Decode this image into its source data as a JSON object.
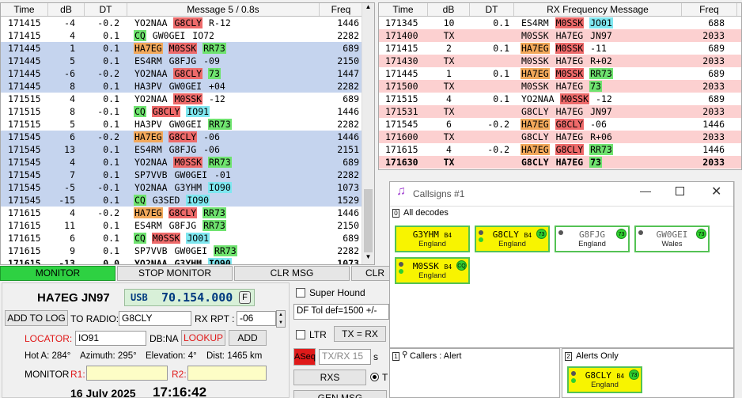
{
  "left_grid": {
    "headers": [
      "Time",
      "dB",
      "DT",
      "Message 5 / 0.8s",
      "Freq"
    ],
    "rows": [
      {
        "t": "171415",
        "db": "-4",
        "dt": "-0.2",
        "msg": [
          [
            "YO2NAA",
            ""
          ],
          [
            "G8CLY",
            "red"
          ],
          [
            "R-12",
            ""
          ]
        ],
        "f": "1446",
        "cls": ""
      },
      {
        "t": "171415",
        "db": "4",
        "dt": "0.1",
        "msg": [
          [
            "CQ",
            "grn"
          ],
          [
            "GW0GEI",
            ""
          ],
          [
            "IO72",
            ""
          ]
        ],
        "f": "2282",
        "cls": ""
      },
      {
        "t": "171445",
        "db": "1",
        "dt": "0.1",
        "msg": [
          [
            "HA7EG",
            "org"
          ],
          [
            "M0SSK",
            "red"
          ],
          [
            "RR73",
            "grn"
          ]
        ],
        "f": "689",
        "cls": "blue-row"
      },
      {
        "t": "171445",
        "db": "5",
        "dt": "0.1",
        "msg": [
          [
            "ES4RM",
            ""
          ],
          [
            "G8FJG",
            ""
          ],
          [
            "-09",
            ""
          ]
        ],
        "f": "2150",
        "cls": "blue-row"
      },
      {
        "t": "171445",
        "db": "-6",
        "dt": "-0.2",
        "msg": [
          [
            "YO2NAA",
            ""
          ],
          [
            "G8CLY",
            "red"
          ],
          [
            "73",
            "grn"
          ]
        ],
        "f": "1447",
        "cls": "blue-row"
      },
      {
        "t": "171445",
        "db": "8",
        "dt": "0.1",
        "msg": [
          [
            "HA3PV",
            ""
          ],
          [
            "GW0GEI",
            ""
          ],
          [
            "+04",
            ""
          ]
        ],
        "f": "2282",
        "cls": "blue-row"
      },
      {
        "t": "171515",
        "db": "4",
        "dt": "0.1",
        "msg": [
          [
            "YO2NAA",
            ""
          ],
          [
            "M0SSK",
            "red"
          ],
          [
            "-12",
            ""
          ]
        ],
        "f": "689",
        "cls": ""
      },
      {
        "t": "171515",
        "db": "8",
        "dt": "-0.1",
        "msg": [
          [
            "CQ",
            "grn"
          ],
          [
            "G8CLY",
            "red"
          ],
          [
            "IO91",
            "cyan"
          ]
        ],
        "f": "1446",
        "cls": ""
      },
      {
        "t": "171515",
        "db": "5",
        "dt": "0.1",
        "msg": [
          [
            "HA3PV",
            ""
          ],
          [
            "GW0GEI",
            ""
          ],
          [
            "RR73",
            "grn"
          ]
        ],
        "f": "2282",
        "cls": ""
      },
      {
        "t": "171545",
        "db": "6",
        "dt": "-0.2",
        "msg": [
          [
            "HA7EG",
            "org"
          ],
          [
            "G8CLY",
            "red"
          ],
          [
            "-06",
            ""
          ]
        ],
        "f": "1446",
        "cls": "blue-row"
      },
      {
        "t": "171545",
        "db": "13",
        "dt": "0.1",
        "msg": [
          [
            "ES4RM",
            ""
          ],
          [
            "G8FJG",
            ""
          ],
          [
            "-06",
            ""
          ]
        ],
        "f": "2151",
        "cls": "blue-row"
      },
      {
        "t": "171545",
        "db": "4",
        "dt": "0.1",
        "msg": [
          [
            "YO2NAA",
            ""
          ],
          [
            "M0SSK",
            "red"
          ],
          [
            "RR73",
            "grn"
          ]
        ],
        "f": "689",
        "cls": "blue-row"
      },
      {
        "t": "171545",
        "db": "7",
        "dt": "0.1",
        "msg": [
          [
            "SP7VVB",
            ""
          ],
          [
            "GW0GEI",
            ""
          ],
          [
            "-01",
            ""
          ]
        ],
        "f": "2282",
        "cls": "blue-row"
      },
      {
        "t": "171545",
        "db": "-5",
        "dt": "-0.1",
        "msg": [
          [
            "YO2NAA",
            ""
          ],
          [
            "G3YHM",
            ""
          ],
          [
            "IO90",
            "cyan"
          ]
        ],
        "f": "1073",
        "cls": "blue-row"
      },
      {
        "t": "171545",
        "db": "-15",
        "dt": "0.1",
        "msg": [
          [
            "CQ",
            "grn"
          ],
          [
            "G3SED",
            ""
          ],
          [
            "IO90",
            "cyan"
          ]
        ],
        "f": "1529",
        "cls": "blue-row"
      },
      {
        "t": "171615",
        "db": "4",
        "dt": "-0.2",
        "msg": [
          [
            "HA7EG",
            "org"
          ],
          [
            "G8CLY",
            "red"
          ],
          [
            "RR73",
            "grn"
          ]
        ],
        "f": "1446",
        "cls": ""
      },
      {
        "t": "171615",
        "db": "11",
        "dt": "0.1",
        "msg": [
          [
            "ES4RM",
            ""
          ],
          [
            "G8FJG",
            ""
          ],
          [
            "RR73",
            "grn"
          ]
        ],
        "f": "2150",
        "cls": ""
      },
      {
        "t": "171615",
        "db": "6",
        "dt": "0.1",
        "msg": [
          [
            "CQ",
            "grn"
          ],
          [
            "M0SSK",
            "red"
          ],
          [
            "JO01",
            "cyan"
          ]
        ],
        "f": "689",
        "cls": ""
      },
      {
        "t": "171615",
        "db": "9",
        "dt": "0.1",
        "msg": [
          [
            "SP7VVB",
            ""
          ],
          [
            "GW0GEI",
            ""
          ],
          [
            "RR73",
            "grn"
          ]
        ],
        "f": "2282",
        "cls": ""
      },
      {
        "t": "171615",
        "db": "-13",
        "dt": "0.0",
        "msg": [
          [
            "YO2NAA",
            ""
          ],
          [
            "G3YHM",
            ""
          ],
          [
            "IO90",
            "cyan"
          ]
        ],
        "f": "1073",
        "cls": "bold"
      }
    ]
  },
  "right_grid": {
    "headers": [
      "Time",
      "dB",
      "DT",
      "RX Frequency Message",
      "Freq"
    ],
    "rows": [
      {
        "t": "171345",
        "db": "10",
        "dt": "0.1",
        "msg": [
          [
            "ES4RM",
            ""
          ],
          [
            "M0SSK",
            "red"
          ],
          [
            "JO01",
            "cyan"
          ]
        ],
        "f": "688",
        "cls": ""
      },
      {
        "t": "171400",
        "db": "TX",
        "dt": "",
        "msg": [
          [
            "M0SSK",
            ""
          ],
          [
            "HA7EG",
            ""
          ],
          [
            "JN97",
            ""
          ]
        ],
        "f": "2033",
        "cls": "pink-row"
      },
      {
        "t": "171415",
        "db": "2",
        "dt": "0.1",
        "msg": [
          [
            "HA7EG",
            "org"
          ],
          [
            "M0SSK",
            "red"
          ],
          [
            "-11",
            ""
          ]
        ],
        "f": "689",
        "cls": ""
      },
      {
        "t": "171430",
        "db": "TX",
        "dt": "",
        "msg": [
          [
            "M0SSK",
            ""
          ],
          [
            "HA7EG",
            ""
          ],
          [
            "R+02",
            ""
          ]
        ],
        "f": "2033",
        "cls": "pink-row"
      },
      {
        "t": "171445",
        "db": "1",
        "dt": "0.1",
        "msg": [
          [
            "HA7EG",
            "org"
          ],
          [
            "M0SSK",
            "red"
          ],
          [
            "RR73",
            "grn"
          ]
        ],
        "f": "689",
        "cls": ""
      },
      {
        "t": "171500",
        "db": "TX",
        "dt": "",
        "msg": [
          [
            "M0SSK",
            ""
          ],
          [
            "HA7EG",
            ""
          ],
          [
            "73",
            "grn"
          ]
        ],
        "f": "2033",
        "cls": "pink-row"
      },
      {
        "t": "171515",
        "db": "4",
        "dt": "0.1",
        "msg": [
          [
            "YO2NAA",
            ""
          ],
          [
            "M0SSK",
            "red"
          ],
          [
            "-12",
            ""
          ]
        ],
        "f": "689",
        "cls": ""
      },
      {
        "t": "171531",
        "db": "TX",
        "dt": "",
        "msg": [
          [
            "G8CLY",
            ""
          ],
          [
            "HA7EG",
            ""
          ],
          [
            "JN97",
            ""
          ]
        ],
        "f": "2033",
        "cls": "pink-row"
      },
      {
        "t": "171545",
        "db": "6",
        "dt": "-0.2",
        "msg": [
          [
            "HA7EG",
            "org"
          ],
          [
            "G8CLY",
            "red"
          ],
          [
            "-06",
            ""
          ]
        ],
        "f": "1446",
        "cls": ""
      },
      {
        "t": "171600",
        "db": "TX",
        "dt": "",
        "msg": [
          [
            "G8CLY",
            ""
          ],
          [
            "HA7EG",
            ""
          ],
          [
            "R+06",
            ""
          ]
        ],
        "f": "2033",
        "cls": "pink-row"
      },
      {
        "t": "171615",
        "db": "4",
        "dt": "-0.2",
        "msg": [
          [
            "HA7EG",
            "org"
          ],
          [
            "G8CLY",
            "red"
          ],
          [
            "RR73",
            "grn"
          ]
        ],
        "f": "1446",
        "cls": ""
      },
      {
        "t": "171630",
        "db": "TX",
        "dt": "",
        "msg": [
          [
            "G8CLY",
            ""
          ],
          [
            "HA7EG",
            ""
          ],
          [
            "73",
            "grn"
          ]
        ],
        "f": "2033",
        "cls": "pink-row bold"
      }
    ]
  },
  "controls": {
    "monitor": "MONITOR",
    "stop_monitor": "STOP MONITOR",
    "clr_msg": "CLR MSG",
    "clr2": "CLR",
    "station": "HA7EG JN97",
    "mode": "USB",
    "freq": "70.154.000",
    "f_btn": "F",
    "add_to_log": "ADD TO LOG",
    "to_radio_label": "TO RADIO:",
    "to_radio_value": "G8CLY",
    "rx_rpt_label": "RX RPT :",
    "rx_rpt_value": "-06",
    "locator_label": "LOCATOR:",
    "locator_value": "IO91",
    "dbna_label": "DB:NA",
    "lookup": "LOOKUP",
    "add": "ADD",
    "hot_a": "Hot A: 284°",
    "azimuth": "Azimuth: 295°",
    "elevation": "Elevation: 4°",
    "dist": "Dist: 1465 km",
    "monitor_label": "MONITOR",
    "r1_label": "R1:",
    "r2_label": "R2:",
    "date": "16 July 2025",
    "time": "17:16:42",
    "super_hound": "Super Hound",
    "df_tol": "DF Tol def=1500 +/-",
    "ltr": "LTR",
    "tx_eq_rx_a": "TX",
    "tx_eq_rx_eq": "=",
    "tx_eq_rx_b": "RX",
    "aseq": "ASeq",
    "txrx": "TX/RX 15",
    "s_unit": "s",
    "rxs": "RXS",
    "t_opt": "T",
    "gen_msg": "GEN MSG"
  },
  "callsigns_window": {
    "title": "Callsigns #1",
    "all_decodes_num": "0",
    "all_decodes": "All decodes",
    "cards": [
      {
        "call": "G3YHM",
        "b": "B4",
        "loc": "England",
        "style": "yellow",
        "badge": "",
        "dots": 0
      },
      {
        "call": "G8CLY",
        "b": "B4",
        "loc": "England",
        "style": "yellow",
        "badge": "73",
        "dots": 2
      },
      {
        "call": "G8FJG",
        "b": "",
        "loc": "England",
        "style": "white",
        "badge": "73",
        "dots": 1
      },
      {
        "call": "GW0GEI",
        "b": "",
        "loc": "Wales",
        "style": "white",
        "badge": "73",
        "dots": 1
      },
      {
        "call": "M0SSK",
        "b": "B4",
        "loc": "England",
        "style": "yellow",
        "badge": "CQ",
        "dots": 2
      }
    ],
    "callers_num": "1",
    "callers_label": "Callers : Alert",
    "alerts_num": "2",
    "alerts_label": "Alerts Only",
    "alert_card": {
      "call": "G8CLY",
      "b": "B4",
      "loc": "England",
      "badge": "73"
    }
  }
}
